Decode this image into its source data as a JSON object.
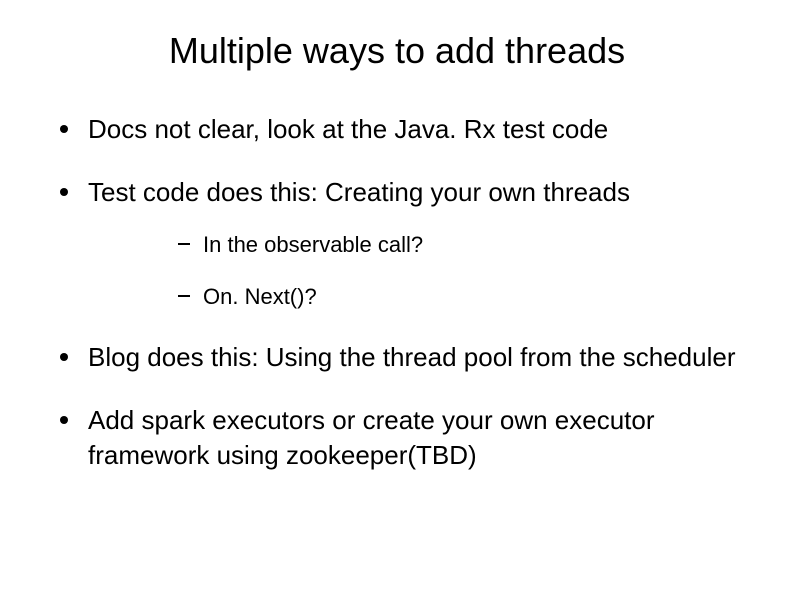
{
  "slide": {
    "title": "Multiple ways to add threads",
    "bullets": [
      {
        "text": "Docs not clear, look at the Java. Rx test code"
      },
      {
        "text": "Test code does this: Creating your own threads",
        "sub": [
          {
            "text": "In the observable call?"
          },
          {
            "text": "On. Next()?"
          }
        ]
      },
      {
        "text": "Blog does this: Using the thread pool from the scheduler"
      },
      {
        "text": "Add spark executors or create your own executor framework using zookeeper(TBD)"
      }
    ]
  }
}
